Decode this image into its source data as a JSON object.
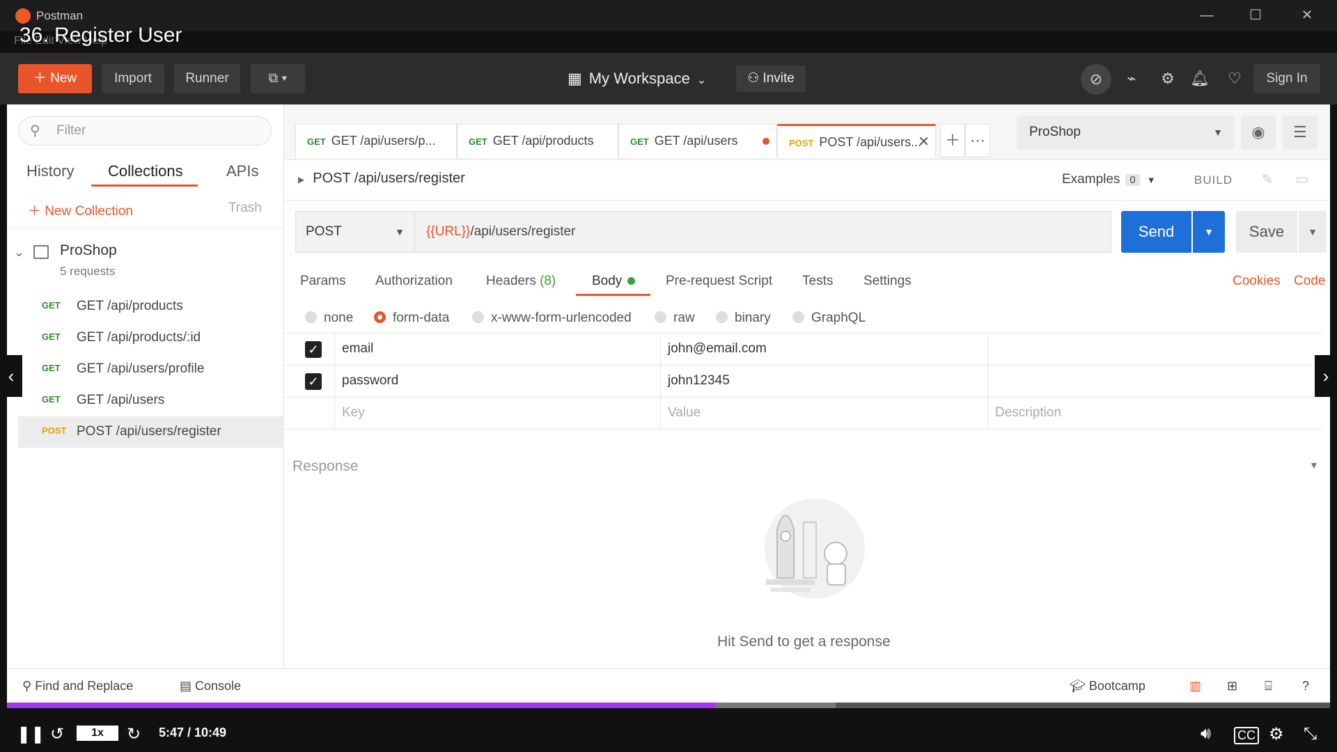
{
  "window": {
    "app_name": "Postman",
    "menu_text": "File  Edit  View  Help",
    "minimize": "—",
    "maximize": "☐",
    "close": "✕"
  },
  "video_title": "36. Register User",
  "header": {
    "new_label": "New",
    "import_label": "Import",
    "runner_label": "Runner",
    "workspace_label": "My Workspace",
    "invite_label": "Invite",
    "signin_label": "Sign In"
  },
  "sidebar": {
    "filter_placeholder": "Filter",
    "tabs": [
      "History",
      "Collections",
      "APIs"
    ],
    "new_collection": "New Collection",
    "trash": "Trash",
    "collection": {
      "name": "ProShop",
      "count": "5 requests"
    },
    "requests": [
      {
        "method": "GET",
        "path": "GET /api/products"
      },
      {
        "method": "GET",
        "path": "GET /api/products/:id"
      },
      {
        "method": "GET",
        "path": "GET /api/users/profile"
      },
      {
        "method": "GET",
        "path": "GET /api/users"
      },
      {
        "method": "POST",
        "path": "POST /api/users/register"
      }
    ]
  },
  "tabs": [
    {
      "method": "GET",
      "label": "GET /api/users/p..."
    },
    {
      "method": "GET",
      "label": "GET /api/products"
    },
    {
      "method": "GET",
      "label": "GET /api/users"
    },
    {
      "method": "POST",
      "label": "POST /api/users..."
    }
  ],
  "environment": "ProShop",
  "request": {
    "title": "POST /api/users/register",
    "examples_label": "Examples",
    "examples_count": "0",
    "build_label": "BUILD",
    "method": "POST",
    "url_var": "{{URL}}",
    "url_path": "/api/users/register",
    "send_label": "Send",
    "save_label": "Save"
  },
  "subtabs": {
    "params": "Params",
    "authorization": "Authorization",
    "headers": "Headers",
    "headers_count": "(8)",
    "body": "Body",
    "prerequest": "Pre-request Script",
    "tests": "Tests",
    "settings": "Settings",
    "cookies": "Cookies",
    "code": "Code"
  },
  "body_types": [
    "none",
    "form-data",
    "x-www-form-urlencoded",
    "raw",
    "binary",
    "GraphQL"
  ],
  "form_rows": [
    {
      "key": "email",
      "value": "john@email.com"
    },
    {
      "key": "password",
      "value": "john12345"
    }
  ],
  "placeholders": {
    "key": "Key",
    "value": "Value",
    "description": "Description"
  },
  "response": {
    "title": "Response",
    "empty_text": "Hit Send to get a response"
  },
  "footer": {
    "find_replace": "Find and Replace",
    "console": "Console",
    "bootcamp": "Bootcamp"
  },
  "video": {
    "speed": "1x",
    "time": "5:47 / 10:49",
    "progress": 0.535
  }
}
